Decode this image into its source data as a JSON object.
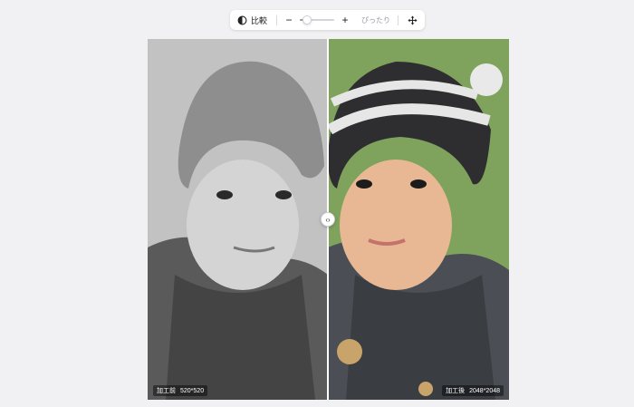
{
  "toolbar": {
    "compare_label": "比較",
    "fit_label": "ぴったり",
    "zoom_minus": "−",
    "zoom_plus": "+",
    "zoom_level": 0.2
  },
  "icons": {
    "compare": "half-circle-icon",
    "zoom_out": "minus-icon",
    "zoom_in": "plus-icon",
    "move": "move-arrows-icon",
    "divider": "left-right-arrows-icon"
  },
  "before": {
    "label": "加工前",
    "size": "520*520"
  },
  "after": {
    "label": "加工後",
    "size": "2048*2048"
  },
  "divider_glyph": "‹›",
  "colors": {
    "page_bg": "#f1f1f4",
    "toolbar_bg": "#ffffff",
    "after_bg": "#7fa35c",
    "before_bg": "#b9b9b9"
  }
}
